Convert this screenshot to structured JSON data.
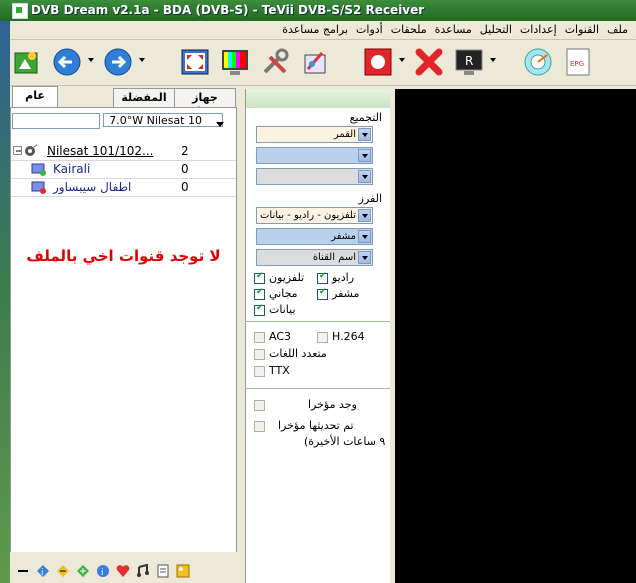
{
  "window": {
    "title": "DVB Dream v2.1a - BDA (DVB-S)  -  TeVii DVB-S/S2 Receiver"
  },
  "menu": {
    "items": [
      "ملف",
      "القنوات",
      "إعدادات",
      "التحليل",
      "مساعدة",
      "ملحقات",
      "أدوات",
      "برامج مساعدة"
    ]
  },
  "toolbar": {
    "icons": [
      "scan-icon",
      "back-icon",
      "forward-icon",
      "fullscreen-icon",
      "color-bars-icon",
      "tools-icon",
      "settings-icon",
      "record-icon",
      "stop-icon",
      "terminal-icon",
      "radar-icon",
      "epg-icon"
    ],
    "epg_label": "EPG",
    "terminal_label": "R"
  },
  "left_panel": {
    "tabs": [
      "عام",
      "المفضلة",
      "جهاز التحكّم"
    ],
    "satellite_select": "7.0°W Nilesat 10",
    "tree": {
      "root": {
        "label": "Nilesat 101/102...",
        "count": "2"
      },
      "children": [
        {
          "label": "Kairali",
          "count": "0"
        },
        {
          "label": "اطفال سيبساور",
          "count": "0"
        }
      ]
    },
    "message": "لا توجد قنوات اخي بالملف"
  },
  "filter_panel": {
    "grouping_label": "التجميع",
    "grouping_combo1": "القمر",
    "grouping_combo2": "",
    "grouping_combo3": "",
    "sorting_label": "الفرز",
    "sort_combo1": "تلفزيون - راديو - بيانات",
    "sort_combo2": "مشفر",
    "sort_combo3": "اسم القناة",
    "checks": {
      "radio": {
        "label": "راديو",
        "checked": true
      },
      "tv": {
        "label": "تلفزيون",
        "checked": true
      },
      "encrypted": {
        "label": "مشفر",
        "checked": true
      },
      "free": {
        "label": "مجاني",
        "checked": true
      },
      "data": {
        "label": "بيانات",
        "checked": true
      }
    },
    "formats": {
      "ac3": "AC3",
      "h264": "H.264",
      "multilang": "متعدد اللغات",
      "ttx": "TTX"
    },
    "recent": {
      "found_recently": "وجد مؤخرا",
      "updated_recently": "تم تحديثها مؤخرا",
      "last_hours": "٩ ساعات الأخيرة)"
    }
  },
  "colors": {
    "titlebar": "#2d7a2d",
    "message_red": "#e10000",
    "combo_blue": "#b9d1ea",
    "combo_gray": "#dcdcdc",
    "combo_peach": "#fdf3e3"
  }
}
